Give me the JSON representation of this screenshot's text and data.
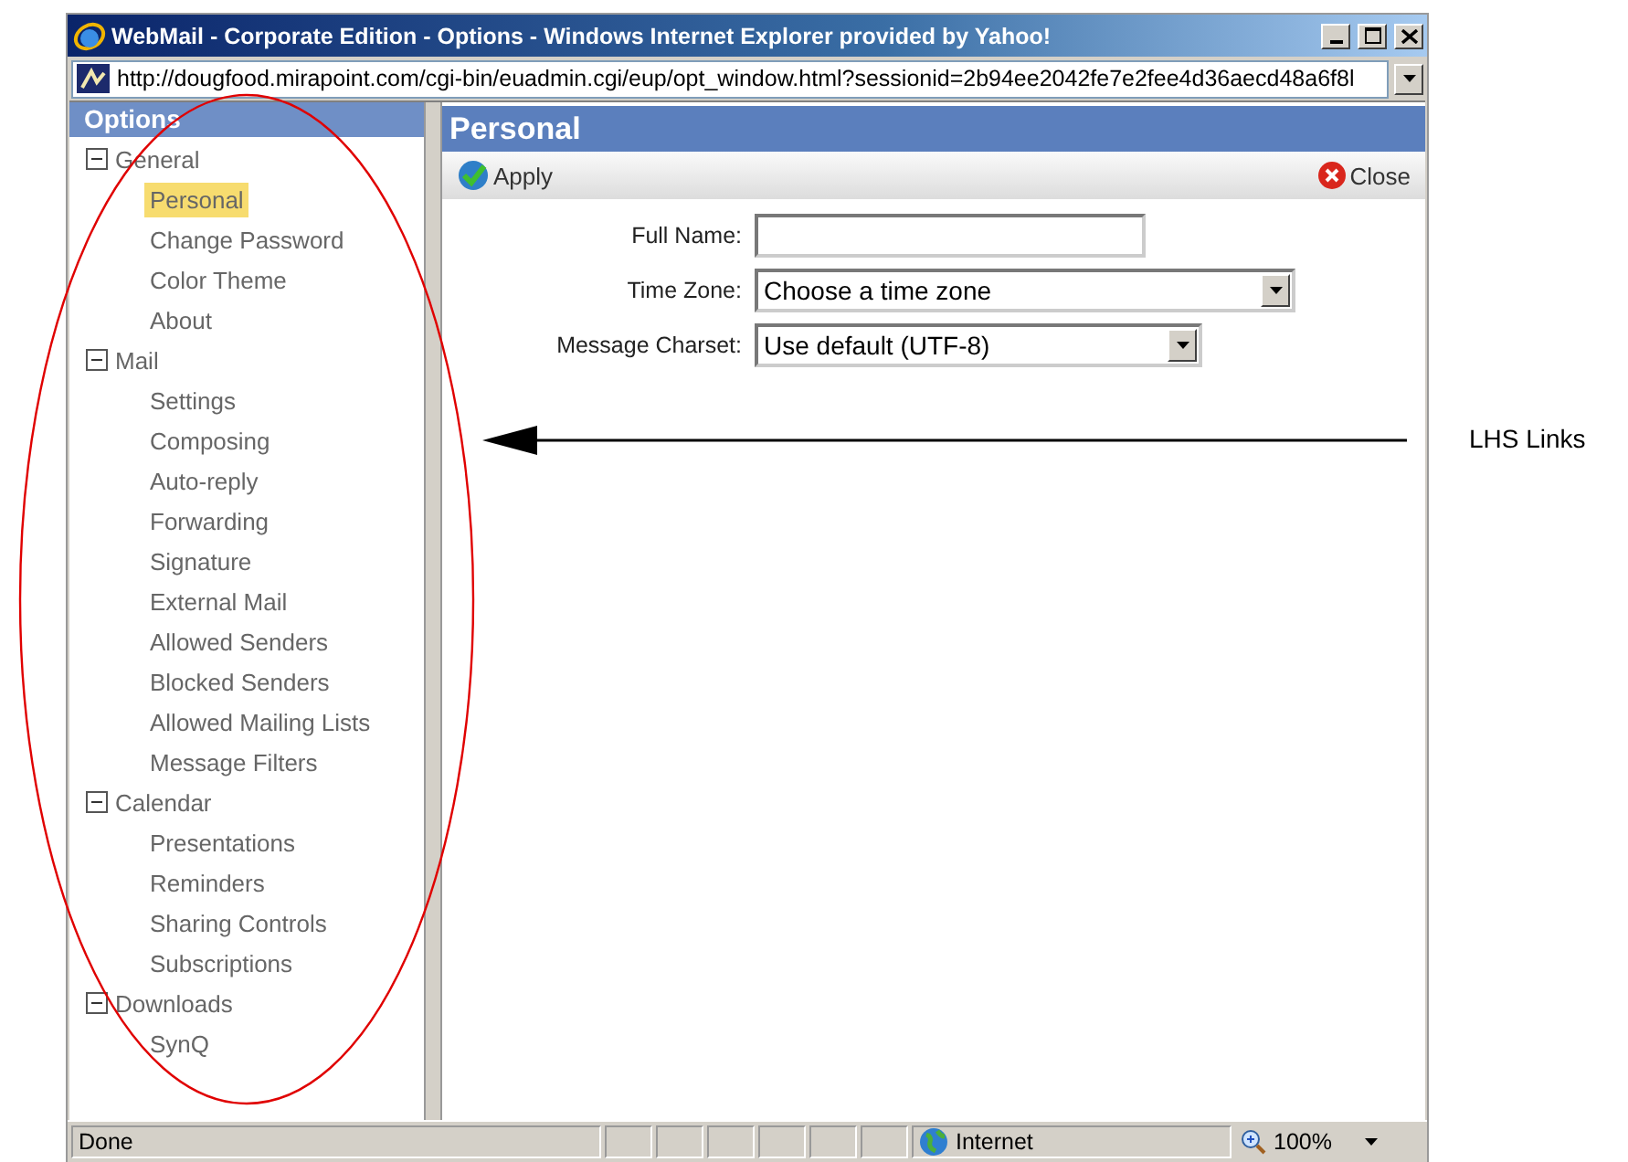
{
  "window": {
    "title": "WebMail - Corporate Edition - Options - Windows Internet Explorer provided by Yahoo!"
  },
  "address_bar": {
    "value": "http://dougfood.mirapoint.com/cgi-bin/euadmin.cgi/eup/opt_window.html?sessionid=2b94ee2042fe7e2fee4d36aecd48a6f8l"
  },
  "sidebar": {
    "title": "Options",
    "items": [
      {
        "label": "General",
        "expanded": true,
        "children": [
          {
            "label": "Personal",
            "selected": true
          },
          {
            "label": "Change Password",
            "selected": false
          },
          {
            "label": "Color Theme",
            "selected": false
          },
          {
            "label": "About",
            "selected": false
          }
        ]
      },
      {
        "label": "Mail",
        "expanded": true,
        "children": [
          {
            "label": "Settings",
            "selected": false
          },
          {
            "label": "Composing",
            "selected": false
          },
          {
            "label": "Auto-reply",
            "selected": false
          },
          {
            "label": "Forwarding",
            "selected": false
          },
          {
            "label": "Signature",
            "selected": false
          },
          {
            "label": "External Mail",
            "selected": false
          },
          {
            "label": "Allowed Senders",
            "selected": false
          },
          {
            "label": "Blocked Senders",
            "selected": false
          },
          {
            "label": "Allowed Mailing Lists",
            "selected": false
          },
          {
            "label": "Message Filters",
            "selected": false
          }
        ]
      },
      {
        "label": "Calendar",
        "expanded": true,
        "children": [
          {
            "label": "Presentations",
            "selected": false
          },
          {
            "label": "Reminders",
            "selected": false
          },
          {
            "label": "Sharing Controls",
            "selected": false
          },
          {
            "label": "Subscriptions",
            "selected": false
          }
        ]
      },
      {
        "label": "Downloads",
        "expanded": true,
        "children": [
          {
            "label": "SynQ",
            "selected": false
          }
        ]
      }
    ]
  },
  "main": {
    "title": "Personal",
    "toolbar": [
      {
        "kind": "apply",
        "label": "Apply"
      },
      {
        "kind": "close",
        "label": "Close"
      }
    ],
    "fields": [
      {
        "kind": "text",
        "label": "Full Name:"
      },
      {
        "kind": "select",
        "label": "Time Zone:",
        "value": "Choose a time zone"
      },
      {
        "kind": "select",
        "label": "Message Charset:",
        "value": "Use default (UTF-8)"
      }
    ]
  },
  "status_bar": {
    "status": "Done",
    "zone": "Internet",
    "zoom": "100%"
  },
  "annotation": {
    "label": "LHS Links"
  }
}
